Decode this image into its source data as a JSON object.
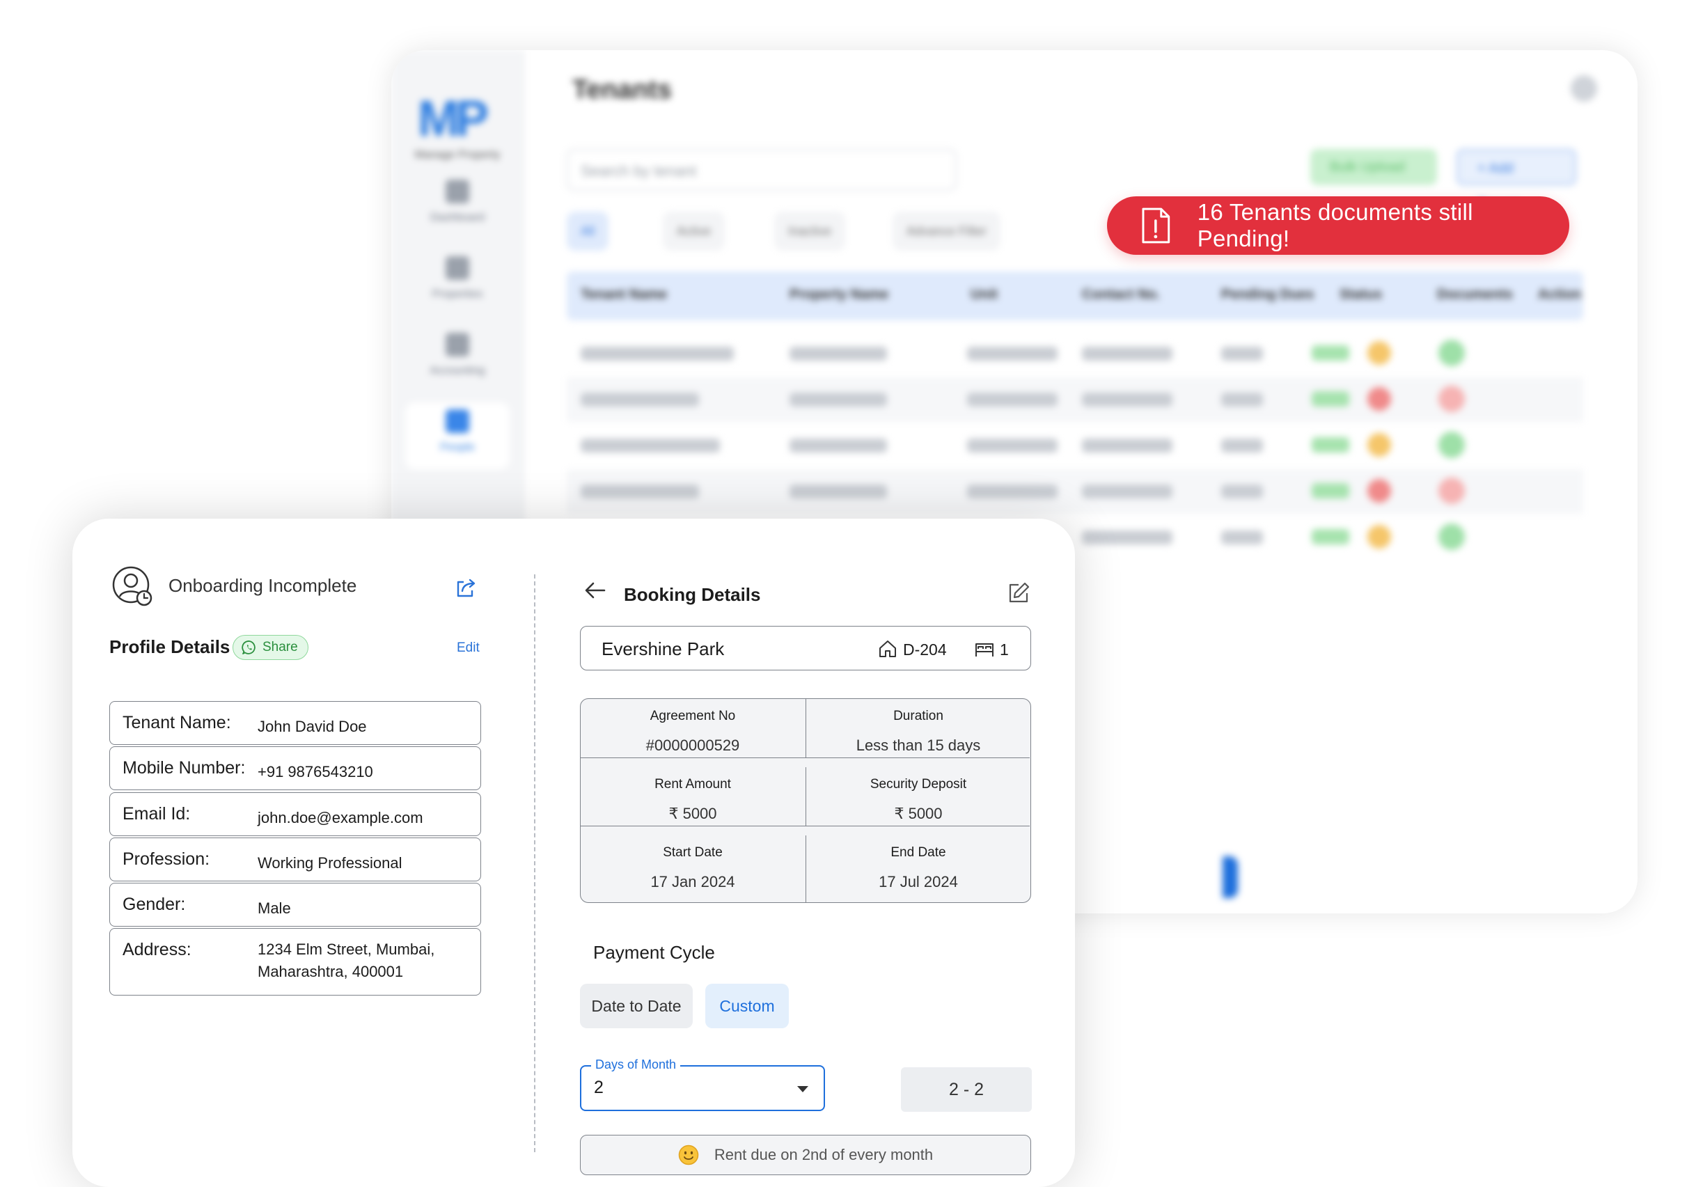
{
  "background_app": {
    "logo": "MP",
    "logo_subtitle": "Manage Property",
    "page_title": "Tenants",
    "sidebar_items": [
      "Dashboard",
      "Properties",
      "Accounting",
      "People"
    ],
    "search_placeholder": "Search by tenant",
    "bulk_upload_label": "Bulk Upload",
    "add_tenant_label": "+ Add Tenant",
    "filter_chips": [
      "All",
      "Active",
      "Inactive",
      "Advance Filter"
    ],
    "table_headers": [
      "Tenant Name",
      "Property Name",
      "Unit",
      "Contact No.",
      "Pending Dues",
      "Status",
      "Documents",
      "Action"
    ]
  },
  "alert": {
    "text": "16 Tenants documents still Pending!",
    "color": "#e2303d"
  },
  "profile": {
    "status_text": "Onboarding Incomplete",
    "title": "Profile Details",
    "share_label": "Share",
    "edit_label": "Edit",
    "fields": [
      {
        "label": "Tenant Name:",
        "value": "John David Doe"
      },
      {
        "label": "Mobile Number:",
        "value": "+91 9876543210"
      },
      {
        "label": "Email Id:",
        "value": "john.doe@example.com"
      },
      {
        "label": "Profession:",
        "value": "Working Professional"
      },
      {
        "label": "Gender:",
        "value": "Male"
      },
      {
        "label": "Address:",
        "value": "1234 Elm Street, Mumbai, Maharashtra, 400001"
      }
    ]
  },
  "booking": {
    "title": "Booking Details",
    "property_name": "Evershine Park",
    "unit": "D-204",
    "beds": "1",
    "details": [
      {
        "label": "Agreement No",
        "value": "#0000000529"
      },
      {
        "label": "Duration",
        "value": "Less than 15 days"
      },
      {
        "label": "Rent Amount",
        "value": "₹ 5000"
      },
      {
        "label": "Security Deposit",
        "value": "₹ 5000"
      },
      {
        "label": "Start Date",
        "value": "17 Jan 2024"
      },
      {
        "label": "End Date",
        "value": "17 Jul 2024"
      }
    ],
    "payment_cycle_title": "Payment Cycle",
    "cycle_options": [
      "Date to Date",
      "Custom"
    ],
    "selected_cycle": "Custom",
    "days_of_month_label": "Days of Month",
    "days_of_month_value": "2",
    "range_value": "2 - 2",
    "due_message": "Rent due on 2nd of every month",
    "accent_color": "#1e6fdc"
  }
}
